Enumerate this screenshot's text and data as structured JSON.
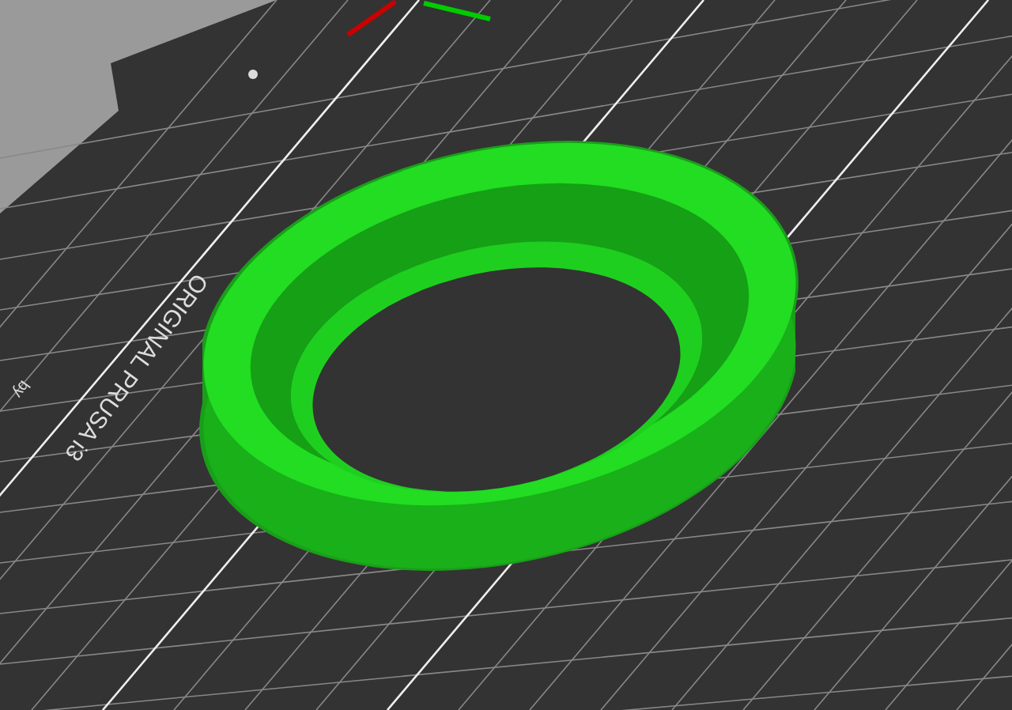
{
  "bed": {
    "label": "ORIGINAL PRUSA i3",
    "sublabel": "by"
  }
}
